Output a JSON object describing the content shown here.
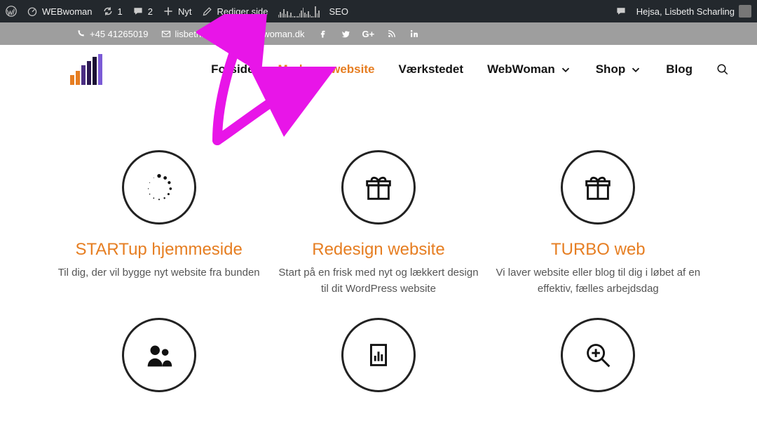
{
  "adminbar": {
    "site_name": "WEBwoman",
    "updates_count": "1",
    "comments_count": "2",
    "new_label": "Nyt",
    "edit_label": "Rediger side",
    "seo_label": "SEO",
    "greeting": "Hejsa, Lisbeth Scharling"
  },
  "topstrip": {
    "phone": "+45 41265019",
    "email_visible": "lisbeth.schar        webwoman.dk"
  },
  "nav": {
    "items": [
      {
        "label": "Forside",
        "active": false
      },
      {
        "label": "Moderne website",
        "active": true
      },
      {
        "label": "Værkstedet",
        "active": false
      },
      {
        "label": "WebWoman",
        "active": false,
        "caret": true
      },
      {
        "label": "Shop",
        "active": false,
        "caret": true
      },
      {
        "label": "Blog",
        "active": false
      }
    ]
  },
  "cards": [
    {
      "title": "STARTup hjemmeside",
      "desc": "Til dig, der vil bygge nyt website fra bunden"
    },
    {
      "title": "Redesign website",
      "desc": "Start på en frisk med nyt og lækkert design til dit WordPress website"
    },
    {
      "title": "TURBO web",
      "desc": "Vi laver website eller blog til dig i løbet af en effektiv, fælles arbejdsdag"
    }
  ],
  "colors": {
    "accent": "#e67e22",
    "annotation": "#e815e8"
  }
}
